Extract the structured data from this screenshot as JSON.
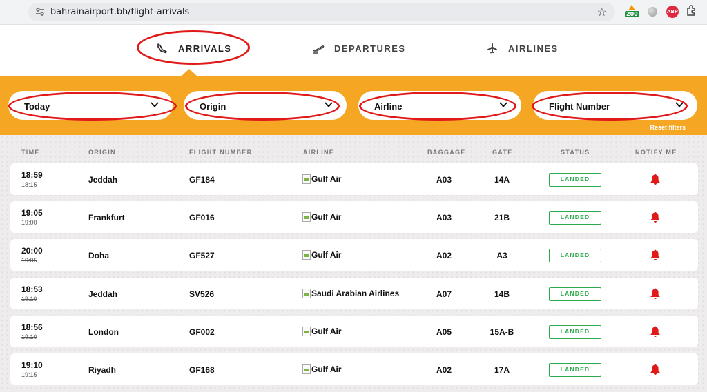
{
  "browser": {
    "url": "bahrainairport.bh/flight-arrivals",
    "extension_badge": "200",
    "abp_label": "ABP"
  },
  "tabs": [
    {
      "label": "ARRIVALS",
      "icon": "plane-landing-icon",
      "active": true
    },
    {
      "label": "DEPARTURES",
      "icon": "plane-takeoff-icon",
      "active": false
    },
    {
      "label": "AIRLINES",
      "icon": "plane-icon",
      "active": false
    }
  ],
  "filters": {
    "date": "Today",
    "origin": "Origin",
    "airline": "Airline",
    "flight_number": "Flight Number",
    "reset": "Reset filters"
  },
  "table": {
    "headers": {
      "time": "TIME",
      "origin": "ORIGIN",
      "flight": "FLIGHT NUMBER",
      "airline": "AIRLINE",
      "baggage": "BAGGAGE",
      "gate": "GATE",
      "status": "STATUS",
      "notify": "NOTIFY ME"
    },
    "rows": [
      {
        "time": "18:59",
        "scheduled": "18:15",
        "origin": "Jeddah",
        "flight": "GF184",
        "airline": "Gulf Air",
        "baggage": "A03",
        "gate": "14A",
        "status": "LANDED"
      },
      {
        "time": "19:05",
        "scheduled": "19:00",
        "origin": "Frankfurt",
        "flight": "GF016",
        "airline": "Gulf Air",
        "baggage": "A03",
        "gate": "21B",
        "status": "LANDED"
      },
      {
        "time": "20:00",
        "scheduled": "19:05",
        "origin": "Doha",
        "flight": "GF527",
        "airline": "Gulf Air",
        "baggage": "A02",
        "gate": "A3",
        "status": "LANDED"
      },
      {
        "time": "18:53",
        "scheduled": "19:10",
        "origin": "Jeddah",
        "flight": "SV526",
        "airline": "Saudi Arabian Airlines",
        "baggage": "A07",
        "gate": "14B",
        "status": "LANDED"
      },
      {
        "time": "18:56",
        "scheduled": "19:10",
        "origin": "London",
        "flight": "GF002",
        "airline": "Gulf Air",
        "baggage": "A05",
        "gate": "15A-B",
        "status": "LANDED"
      },
      {
        "time": "19:10",
        "scheduled": "19:15",
        "origin": "Riyadh",
        "flight": "GF168",
        "airline": "Gulf Air",
        "baggage": "A02",
        "gate": "17A",
        "status": "LANDED"
      }
    ]
  },
  "colors": {
    "accent": "#f5a623",
    "status_landed": "#2eaa4e",
    "bell": "#e01919",
    "annotation": "#e01919"
  }
}
